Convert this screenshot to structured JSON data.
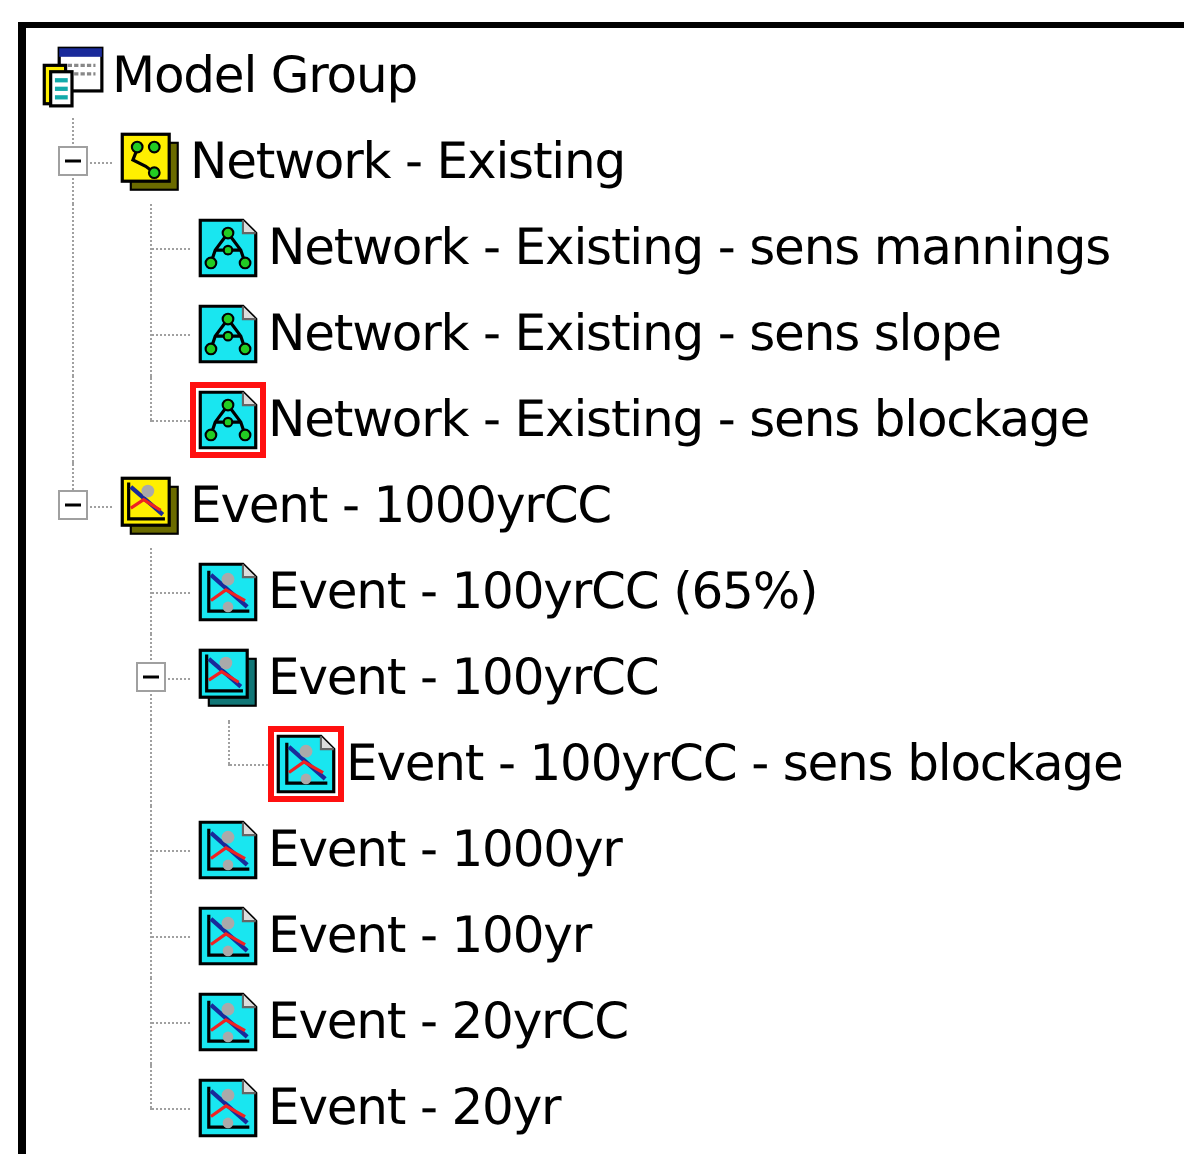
{
  "tree": [
    {
      "label": "Model Group",
      "kind": "model-group",
      "flagged": false,
      "children": [
        {
          "label": "Network - Existing",
          "kind": "network-group",
          "flagged": false,
          "expanded": true,
          "children": [
            {
              "label": "Network - Existing - sens mannings",
              "kind": "network",
              "flagged": false
            },
            {
              "label": "Network - Existing - sens slope",
              "kind": "network",
              "flagged": false
            },
            {
              "label": "Network - Existing - sens blockage",
              "kind": "network",
              "flagged": true
            }
          ]
        },
        {
          "label": "Event - 1000yrCC",
          "kind": "event-group",
          "flagged": false,
          "expanded": true,
          "children": [
            {
              "label": "Event - 100yrCC (65%)",
              "kind": "event",
              "flagged": false
            },
            {
              "label": "Event - 100yrCC",
              "kind": "event-stack",
              "flagged": false,
              "expanded": true,
              "children": [
                {
                  "label": "Event - 100yrCC - sens blockage",
                  "kind": "event",
                  "flagged": true
                }
              ]
            },
            {
              "label": "Event - 1000yr",
              "kind": "event",
              "flagged": false
            },
            {
              "label": "Event - 100yr",
              "kind": "event",
              "flagged": false
            },
            {
              "label": "Event - 20yrCC",
              "kind": "event",
              "flagged": false
            },
            {
              "label": "Event - 20yr",
              "kind": "event",
              "flagged": false
            }
          ]
        }
      ]
    }
  ]
}
